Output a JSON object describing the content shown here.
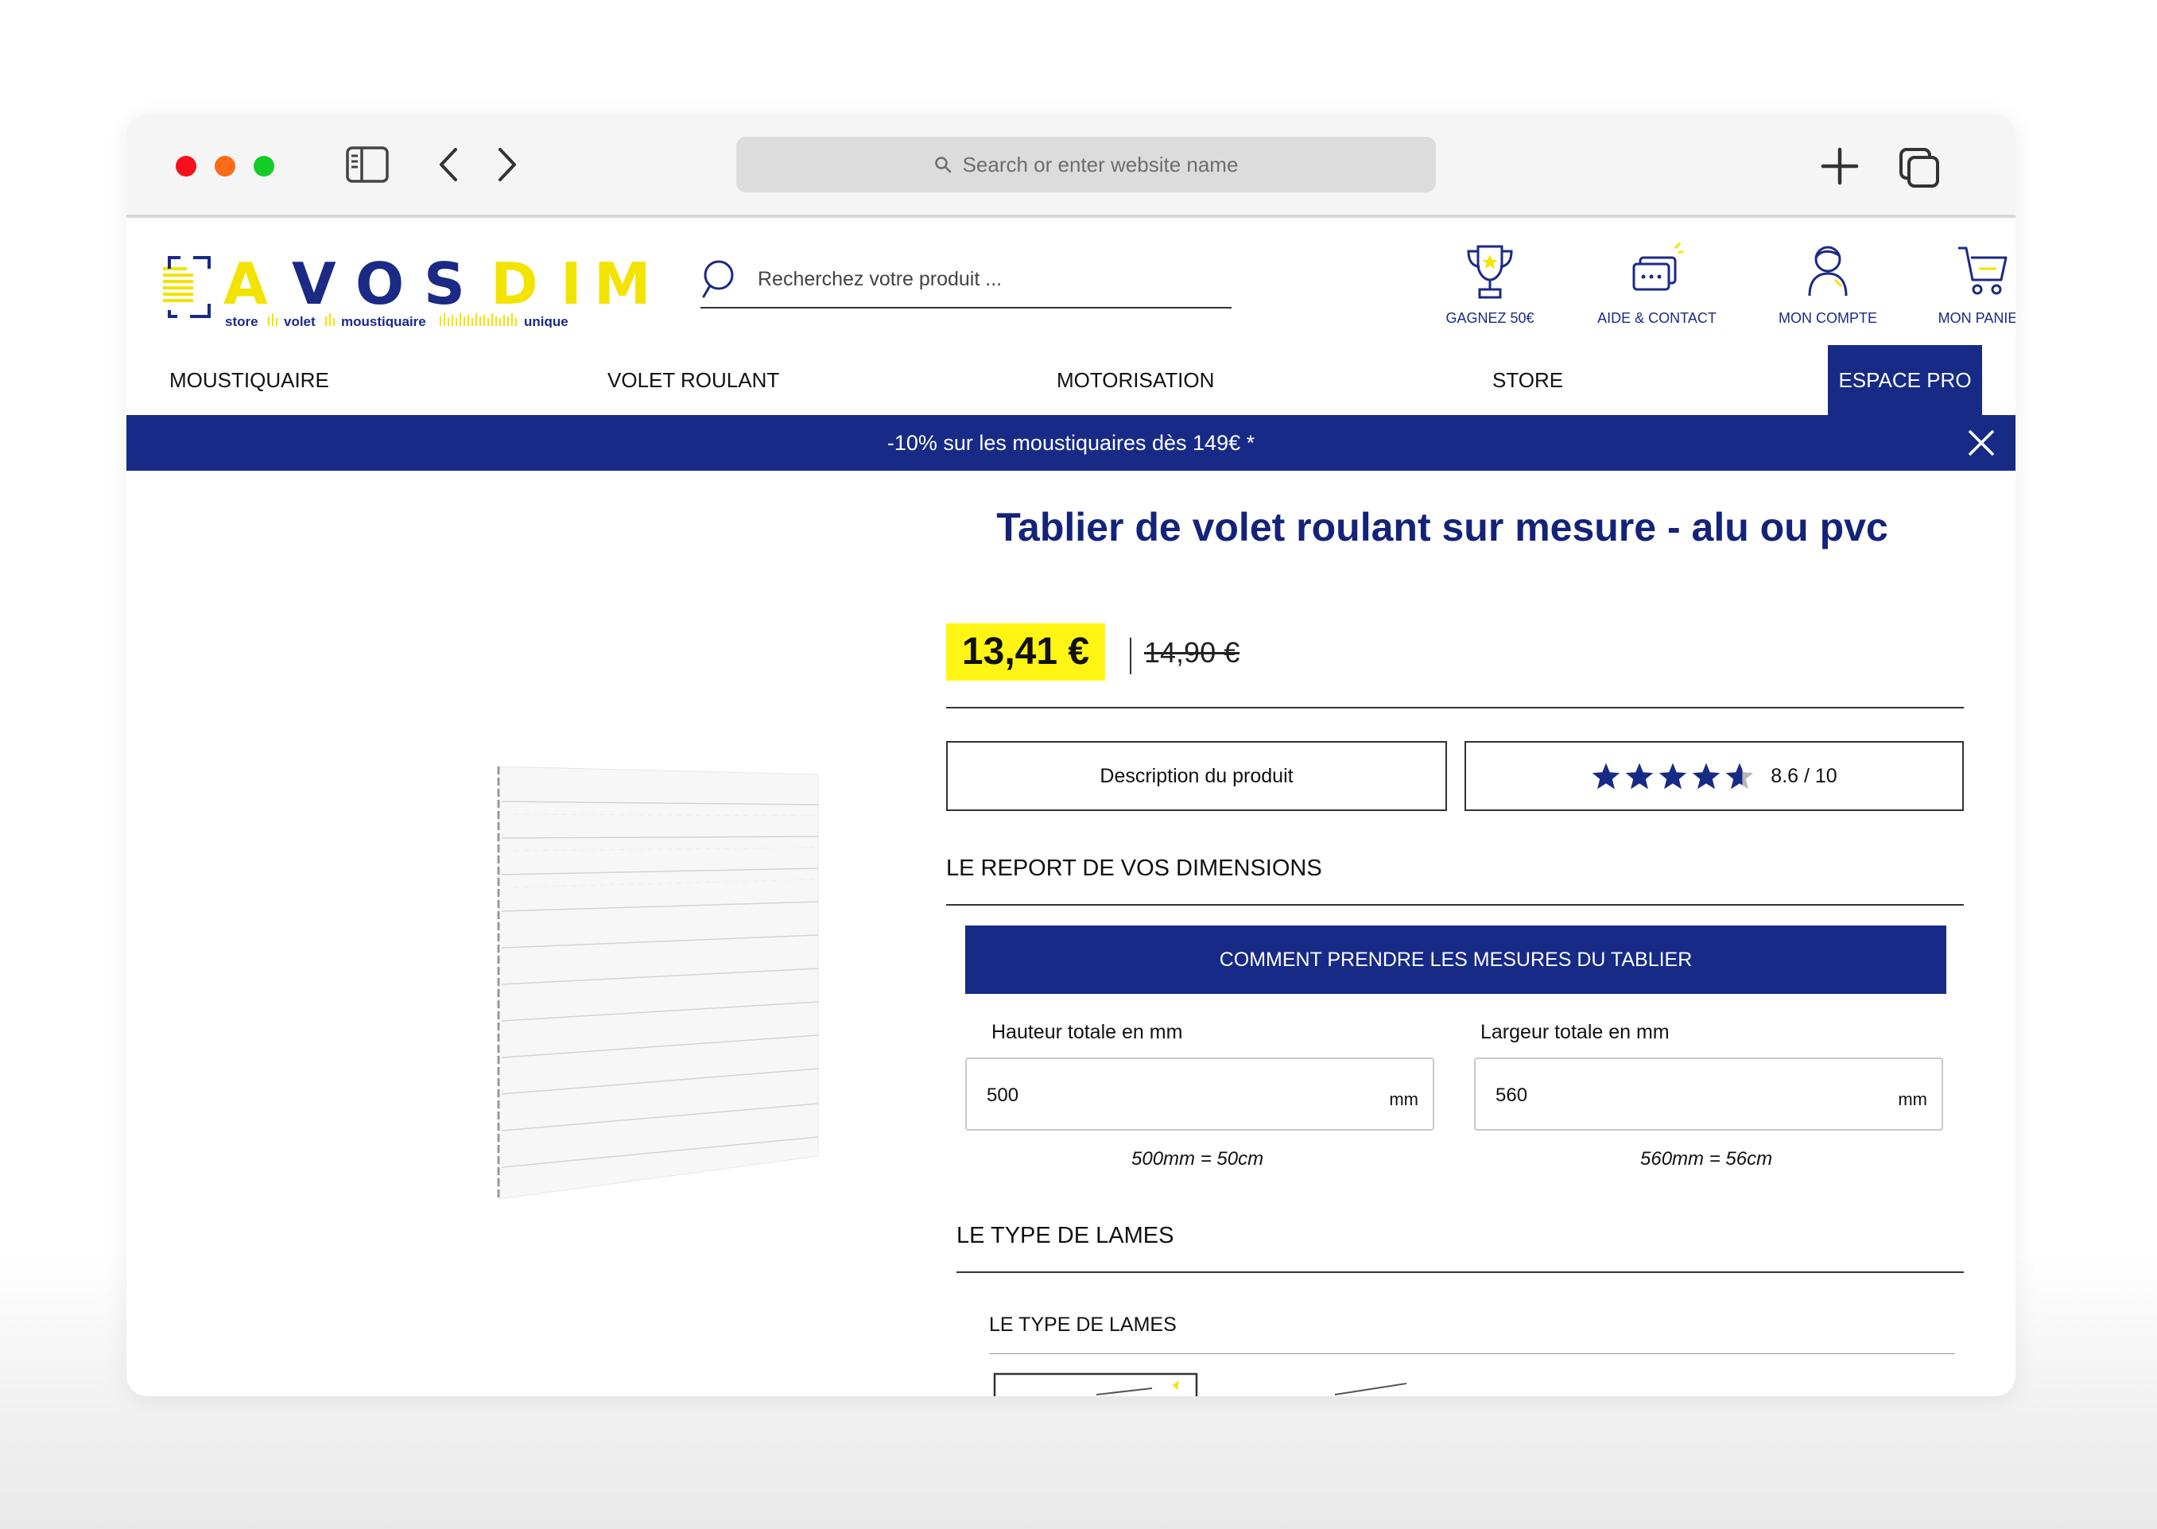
{
  "browser": {
    "url_placeholder": "Search or enter website name"
  },
  "site": {
    "logo_letters": [
      "A",
      "V",
      "O",
      "S",
      "D",
      "I",
      "M"
    ],
    "tagline_words": [
      "store",
      "volet",
      "moustiquaire",
      "unique"
    ],
    "search_placeholder": "Recherchez votre produit ...",
    "header_links": [
      {
        "label": "GAGNEZ 50€",
        "icon": "trophy-icon"
      },
      {
        "label": "AIDE & CONTACT",
        "icon": "chat-icon"
      },
      {
        "label": "MON COMPTE",
        "icon": "user-icon"
      },
      {
        "label": "MON PANIER",
        "icon": "cart-icon"
      }
    ],
    "nav": [
      "MOUSTIQUAIRE",
      "VOLET ROULANT",
      "MOTORISATION",
      "STORE",
      "ESPACE PRO"
    ],
    "promo": "-10% sur les moustiquaires dès 149€ *",
    "colors": {
      "brand_blue": "#172a86",
      "brand_yellow": "#fff514"
    }
  },
  "product": {
    "title": "Tablier de volet roulant sur mesure - alu ou pvc",
    "price": "13,41 €",
    "old_price": "14,90 €",
    "tab_description": "Description du produit",
    "rating_text": "8.6 / 10",
    "rating_value": 8.6,
    "rating_max": 10,
    "dimensions_title": "LE REPORT DE VOS DIMENSIONS",
    "measure_button": "COMMENT PRENDRE LES MESURES DU TABLIER",
    "height": {
      "label": "Hauteur totale en mm",
      "value": "500",
      "unit": "mm",
      "conversion": "500mm = 50cm"
    },
    "width": {
      "label": "Largeur totale en mm",
      "value": "560",
      "unit": "mm",
      "conversion": "560mm = 56cm"
    },
    "slats_title": "LE TYPE DE LAMES",
    "slats_subtitle": "LE TYPE DE LAMES"
  }
}
